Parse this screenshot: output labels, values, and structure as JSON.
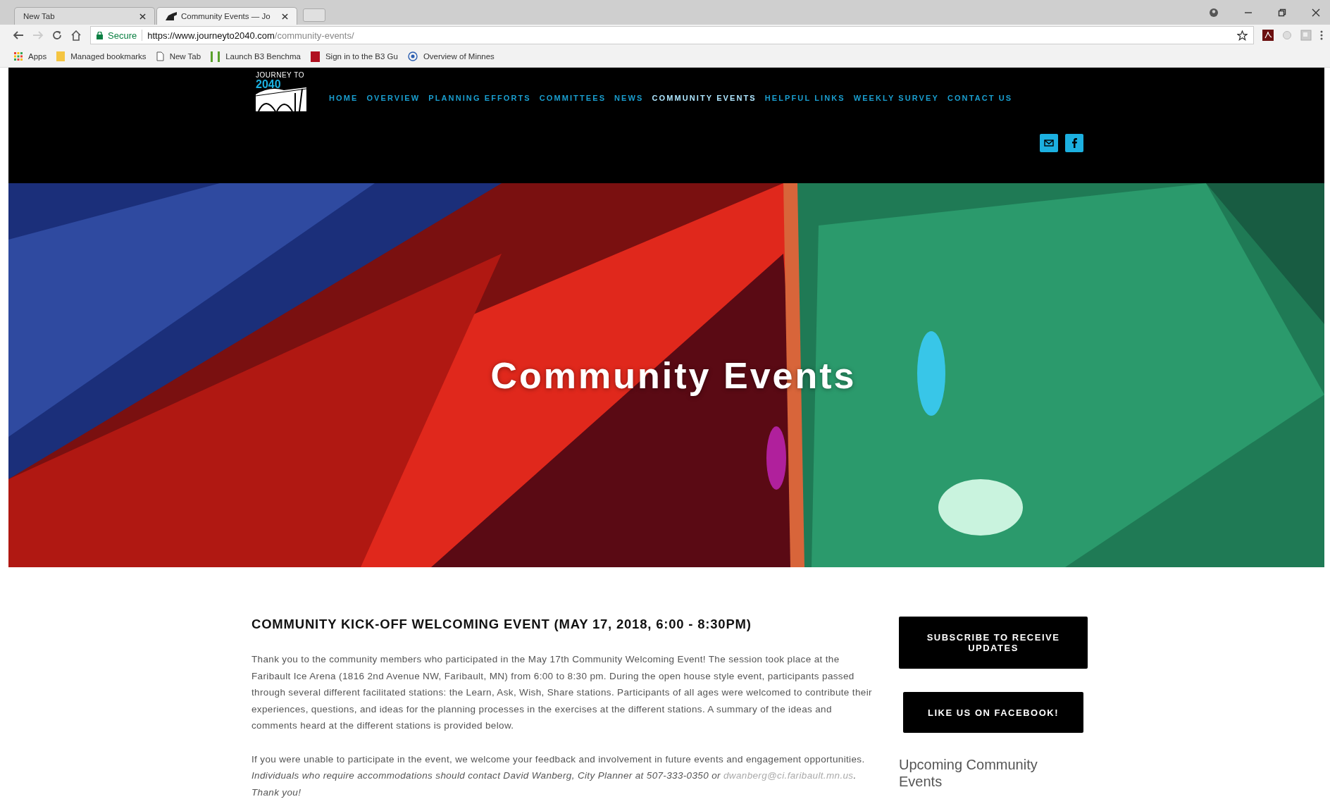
{
  "browser": {
    "tabs": [
      {
        "title": "New Tab",
        "selected": false
      },
      {
        "title": "Community Events — Jo",
        "selected": true
      }
    ],
    "address": {
      "secure_label": "Secure",
      "url_host": "https://www.journeyto2040.com",
      "url_path": "/community-events/"
    },
    "bookmarks": [
      {
        "kind": "apps",
        "label": "Apps"
      },
      {
        "kind": "folder",
        "label": "Managed bookmarks"
      },
      {
        "kind": "page",
        "label": "New Tab"
      },
      {
        "kind": "b3green",
        "label": "Launch B3 Benchma"
      },
      {
        "kind": "b3red",
        "label": "Sign in to the B3 Gu"
      },
      {
        "kind": "globe",
        "label": "Overview of Minnes"
      }
    ]
  },
  "site": {
    "logo": {
      "line1": "JOURNEY TO",
      "line2": "2040"
    },
    "nav": [
      {
        "label": "HOME",
        "selected": false
      },
      {
        "label": "OVERVIEW",
        "selected": false
      },
      {
        "label": "PLANNING EFFORTS",
        "selected": false
      },
      {
        "label": "COMMITTEES",
        "selected": false
      },
      {
        "label": "NEWS",
        "selected": false
      },
      {
        "label": "COMMUNITY EVENTS",
        "selected": true
      },
      {
        "label": "HELPFUL LINKS",
        "selected": false
      },
      {
        "label": "WEEKLY SURVEY",
        "selected": false
      },
      {
        "label": "CONTACT US",
        "selected": false
      }
    ],
    "social": [
      {
        "kind": "email"
      },
      {
        "kind": "facebook"
      }
    ]
  },
  "hero": {
    "kind": "picture",
    "title": "Community Events"
  },
  "article": {
    "heading": "COMMUNITY KICK-OFF WELCOMING EVENT (MAY 17, 2018, 6:00 - 8:30PM)",
    "paragraph_1": "Thank you to the community members who participated in the May 17th Community Welcoming Event! The session took place at the Faribault Ice Arena (1816 2nd Avenue NW, Faribault, MN) from 6:00 to 8:30 pm. During the open house style event, participants passed through several different facilitated stations: the Learn, Ask, Wish, Share stations.  Participants of all ages were welcomed to contribute their experiences, questions, and ideas for the planning processes in the exercises at the different stations.  A summary of the ideas and comments heard at the different stations is provided below.",
    "paragraph_2": "If you were unable to participate in the event, we welcome your feedback and involvement in future events and engagement opportunities.  *Individuals who require accommodations should contact David Wanberg, City Planner at 507-333-0350 or*",
    "email_link": "dwanberg@ci.faribault.mn.us",
    "paragraph_2_end": "*. Thank you!*"
  },
  "sidebar": {
    "buttons": [
      "SUBSCRIBE TO RECEIVE UPDATES",
      "LIKE US ON FACEBOOK!"
    ],
    "upcoming_heading": "Upcoming Community Events"
  }
}
